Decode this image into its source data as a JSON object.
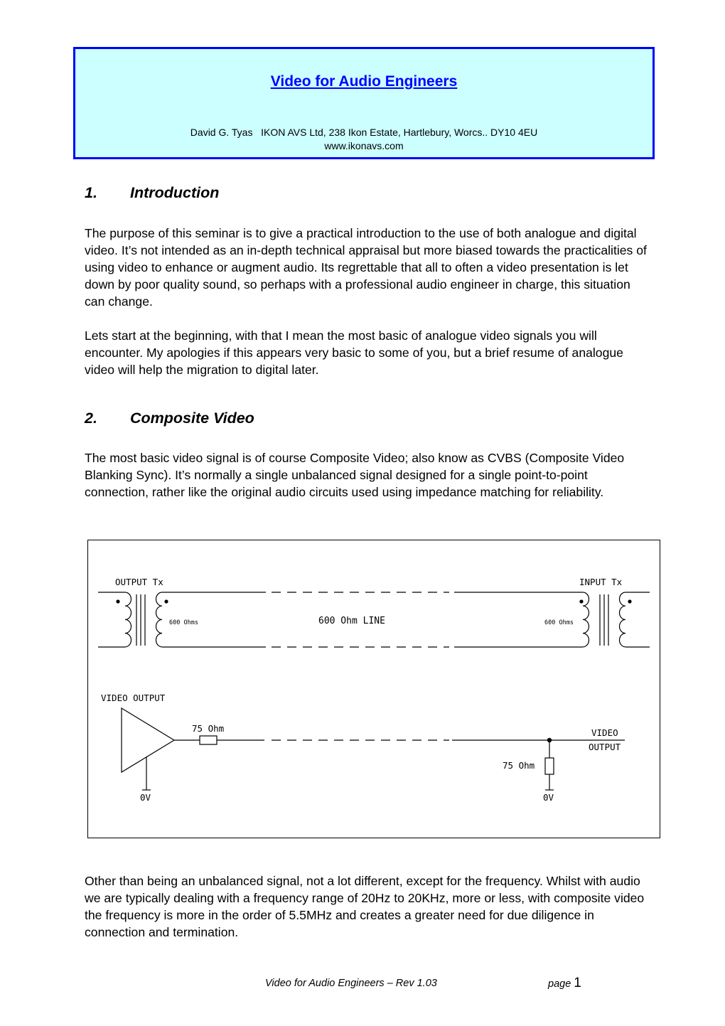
{
  "header": {
    "title": "Video for Audio Engineers",
    "author_line": "David G. Tyas   IKON AVS Ltd, 238 Ikon Estate, Hartlebury, Worcs.. DY10 4EU",
    "website": "www.ikonavs.com"
  },
  "sections": [
    {
      "number": "1.",
      "title": "Introduction",
      "paragraphs": [
        "The purpose of this seminar is to give a practical introduction to the use of both analogue and digital video. It’s not intended as an in-depth technical appraisal but more biased towards the practicalities of using video to enhance or augment audio. Its regrettable that all to often a video presentation is let down by poor quality sound, so perhaps with a professional audio engineer in charge, this situation can change.",
        "Lets start at the beginning, with that I mean the most basic of analogue video signals you will encounter. My apologies if this appears very basic to some of you, but a brief resume of analogue video will help the migration to digital later."
      ]
    },
    {
      "number": "2.",
      "title": "Composite Video",
      "paragraphs": [
        "The most basic video signal is of course Composite Video; also know as CVBS (Composite Video Blanking Sync). It’s normally a single unbalanced signal designed for a single point-to-point connection, rather like the original audio circuits used using impedance matching for reliability.",
        "Other than being an unbalanced signal, not a lot different, except for the frequency. Whilst with audio we are typically dealing with a frequency range of 20Hz to 20KHz, more or less, with composite video the frequency is more in the order of 5.5MHz and creates a greater need for due diligence in connection and termination."
      ]
    }
  ],
  "diagram": {
    "output_tx_label": "OUTPUT Tx",
    "input_tx_label": "INPUT Tx",
    "left_winding_label": "600 Ohms",
    "right_winding_label": "600 Ohms",
    "line_label": "600 Ohm LINE",
    "video_output_label": "VIDEO OUTPUT",
    "source_resistor_label": "75 Ohm",
    "load_resistor_label": "75 Ohm",
    "right_output_label_1": "VIDEO",
    "right_output_label_2": "OUTPUT",
    "ground_left_label": "0V",
    "ground_right_label": "0V"
  },
  "footer": {
    "doc_title": "Video for Audio Engineers – Rev 1.03",
    "page_word": "page",
    "page_number": "1"
  }
}
